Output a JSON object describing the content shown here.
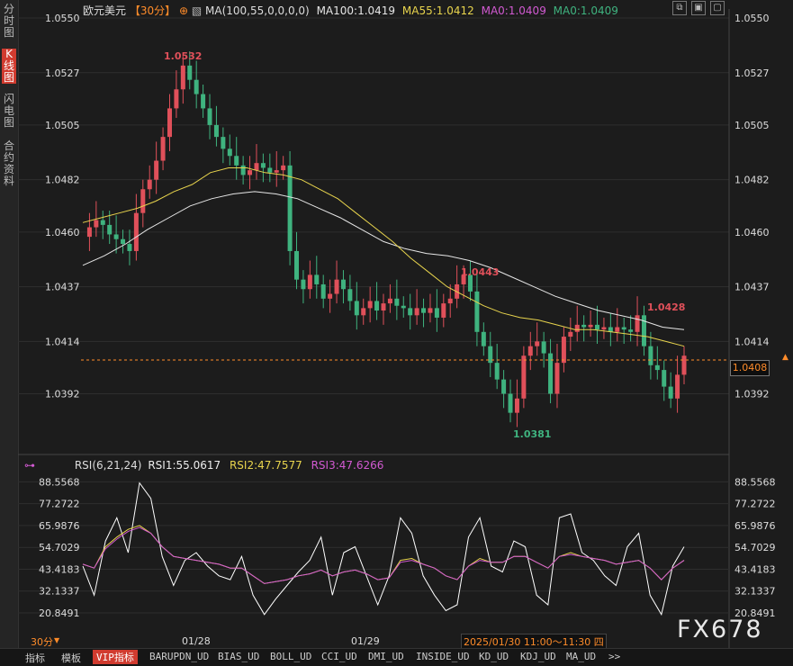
{
  "sidebar": {
    "tabs": [
      {
        "label": "分时图"
      },
      {
        "label": "K线图"
      },
      {
        "label": "闪电图"
      },
      {
        "label": "合约资料"
      }
    ]
  },
  "header": {
    "symbol": "欧元美元",
    "period": "【30分】",
    "ma_label": "MA(100,55,0,0,0,0)",
    "ma100": "MA100:1.0419",
    "ma55": "MA55:1.0412",
    "ma0a": "MA0:1.0409",
    "ma0b": "MA0:1.0409"
  },
  "rsi_header": {
    "label": "RSI(6,21,24)",
    "rsi1": "RSI1:55.0617",
    "rsi2": "RSI2:47.7577",
    "rsi3": "RSI3:47.6266"
  },
  "price_axis": [
    "1.0550",
    "1.0527",
    "1.0505",
    "1.0482",
    "1.0460",
    "1.0437",
    "1.0414",
    "1.0392"
  ],
  "rsi_axis": [
    "88.5568",
    "77.2722",
    "65.9876",
    "54.7029",
    "43.4183",
    "32.1337",
    "20.8491"
  ],
  "x_labels": [
    "01/28",
    "01/29"
  ],
  "cursor_time": "2025/01/30 11:00～11:30 四",
  "current_price": "1.0408",
  "annotations": {
    "high": "1.0532",
    "mid_high": "1.0443",
    "low": "1.0381",
    "right_high": "1.0428"
  },
  "bottom_period": "30分",
  "bottom_tabs": [
    "指标",
    "模板",
    "VIP指标",
    "BARUPDN_UD",
    "BIAS_UD",
    "BOLL_UD",
    "CCI_UD",
    "DMI_UD",
    "INSIDE_UD",
    "KD_UD",
    "KDJ_UD",
    "MA_UD",
    ">>"
  ],
  "watermark": "FX678",
  "colors": {
    "up": "#e0505a",
    "down": "#3fb37f",
    "ma100": "#e6e6e6",
    "ma55": "#e8d44d",
    "rsi1": "#ffffff",
    "rsi2": "#e8d44d",
    "rsi3": "#d25ad2"
  },
  "chart_data": [
    {
      "type": "candlestick",
      "title": "欧元美元 30分",
      "y_axis_ticks": [
        1.055,
        1.0527,
        1.0505,
        1.0482,
        1.046,
        1.0437,
        1.0414,
        1.0392
      ],
      "ylim": [
        1.0371,
        1.055
      ],
      "x_ticks": [
        "01/28",
        "01/29"
      ],
      "high": 1.0532,
      "low": 1.0381,
      "last": 1.0408,
      "closes": [
        1.0458,
        1.0462,
        1.0465,
        1.0463,
        1.0459,
        1.0457,
        1.0455,
        1.0452,
        1.0468,
        1.0478,
        1.0482,
        1.049,
        1.05,
        1.0512,
        1.052,
        1.053,
        1.0524,
        1.0518,
        1.0512,
        1.0505,
        1.05,
        1.0495,
        1.0492,
        1.0488,
        1.0484,
        1.0486,
        1.0489,
        1.0487,
        1.0485,
        1.0486,
        1.0488,
        1.0452,
        1.044,
        1.0436,
        1.0442,
        1.0438,
        1.0432,
        1.0434,
        1.044,
        1.0436,
        1.0431,
        1.0425,
        1.0428,
        1.0431,
        1.0427,
        1.043,
        1.0432,
        1.0429,
        1.0428,
        1.0425,
        1.0428,
        1.0426,
        1.0428,
        1.0424,
        1.043,
        1.0432,
        1.0438,
        1.0442,
        1.0435,
        1.0418,
        1.0412,
        1.0405,
        1.0398,
        1.0392,
        1.0384,
        1.039,
        1.0408,
        1.0412,
        1.0414,
        1.0409,
        1.0392,
        1.0405,
        1.0416,
        1.0418,
        1.0421,
        1.042,
        1.0421,
        1.0419,
        1.042,
        1.0418,
        1.042,
        1.0419,
        1.0418,
        1.0425,
        1.0412,
        1.0404,
        1.0402,
        1.0395,
        1.039,
        1.04,
        1.0408
      ],
      "ma55": [
        1.0464,
        1.0466,
        1.0468,
        1.047,
        1.0473,
        1.0477,
        1.048,
        1.0485,
        1.0487,
        1.0487,
        1.0485,
        1.0484,
        1.0482,
        1.0478,
        1.0474,
        1.0468,
        1.0462,
        1.0456,
        1.0449,
        1.0443,
        1.0437,
        1.0433,
        1.0429,
        1.0426,
        1.0424,
        1.0423,
        1.0421,
        1.0419,
        1.0419,
        1.0418,
        1.0417,
        1.0416,
        1.0414,
        1.0412
      ],
      "ma100": [
        1.0446,
        1.045,
        1.0455,
        1.0461,
        1.0466,
        1.0471,
        1.0474,
        1.0476,
        1.0477,
        1.0476,
        1.0474,
        1.047,
        1.0466,
        1.0461,
        1.0456,
        1.0453,
        1.0451,
        1.045,
        1.0448,
        1.0445,
        1.0441,
        1.0437,
        1.0433,
        1.043,
        1.0427,
        1.0425,
        1.0423,
        1.042,
        1.0419
      ],
      "series": [
        {
          "name": "MA100",
          "last": 1.0419
        },
        {
          "name": "MA55",
          "last": 1.0412
        }
      ]
    },
    {
      "type": "line",
      "title": "RSI(6,21,24)",
      "y_axis_ticks": [
        88.5568,
        77.2722,
        65.9876,
        54.7029,
        43.4183,
        32.1337,
        20.8491
      ],
      "ylim": [
        12,
        92
      ],
      "series": [
        {
          "name": "RSI1",
          "values": [
            45,
            30,
            58,
            70,
            52,
            88,
            80,
            50,
            35,
            48,
            52,
            45,
            40,
            38,
            50,
            30,
            20,
            28,
            35,
            42,
            48,
            60,
            30,
            52,
            55,
            40,
            25,
            40,
            70,
            62,
            40,
            30,
            22,
            25,
            60,
            70,
            45,
            42,
            58,
            55,
            30,
            25,
            70,
            72,
            52,
            48,
            40,
            35,
            55,
            62,
            30,
            20,
            45,
            55
          ]
        },
        {
          "name": "RSI2",
          "values": [
            46,
            44,
            55,
            60,
            64,
            66,
            62,
            55,
            50,
            49,
            48,
            47,
            46,
            44,
            44,
            40,
            36,
            37,
            38,
            40,
            41,
            43,
            40,
            42,
            43,
            41,
            38,
            39,
            48,
            49,
            46,
            44,
            40,
            38,
            45,
            49,
            47,
            47,
            50,
            50,
            47,
            44,
            50,
            52,
            50,
            49,
            48,
            46,
            47,
            48,
            44,
            38,
            44,
            48
          ]
        },
        {
          "name": "RSI3",
          "values": [
            46,
            44,
            54,
            59,
            63,
            65,
            62,
            55,
            50,
            49,
            48,
            47,
            46,
            44,
            44,
            40,
            36,
            37,
            38,
            40,
            41,
            43,
            40,
            42,
            43,
            41,
            38,
            39,
            47,
            48,
            46,
            44,
            40,
            38,
            45,
            48,
            47,
            47,
            50,
            50,
            47,
            44,
            50,
            51,
            50,
            49,
            48,
            46,
            47,
            48,
            44,
            38,
            44,
            48
          ]
        }
      ]
    }
  ]
}
